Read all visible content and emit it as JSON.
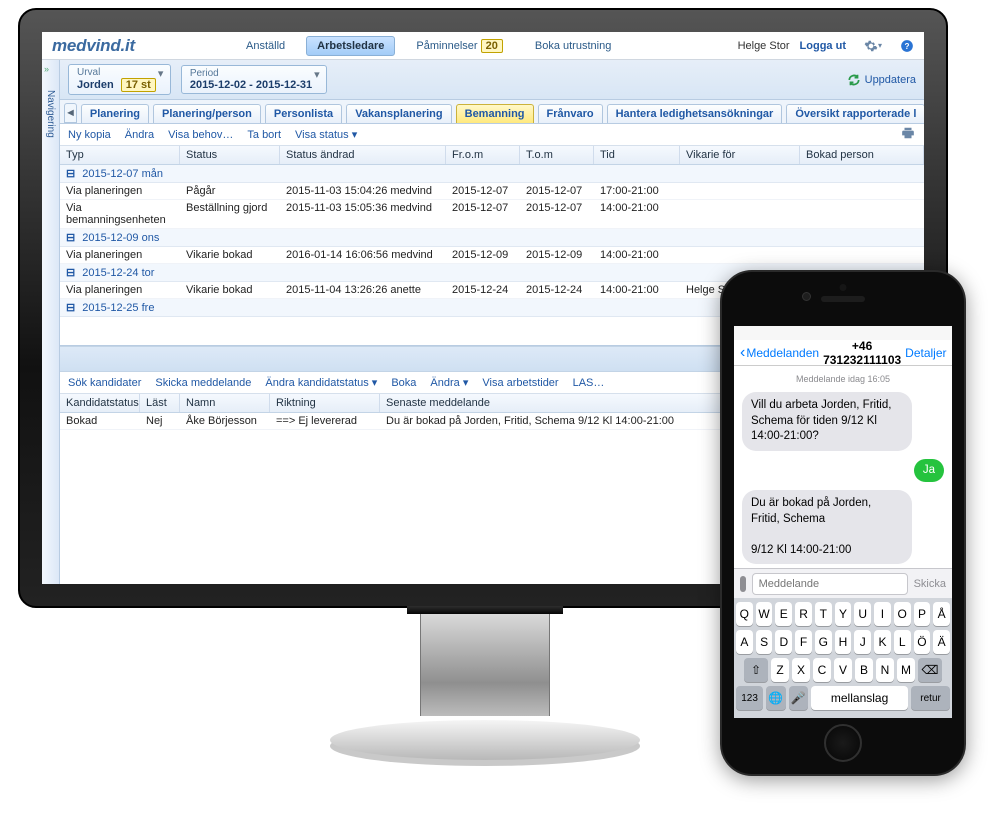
{
  "app": {
    "logo": "medvind.it"
  },
  "topnav": {
    "items": [
      "Anställd",
      "Arbetsledare",
      "Påminnelser",
      "Boka utrustning"
    ],
    "active": 1,
    "reminder_count": "20",
    "user": "Helge Stor",
    "logout": "Logga ut"
  },
  "sidenav": {
    "label": "Navigering"
  },
  "selection": {
    "urval_label": "Urval",
    "urval_value": "Jorden",
    "urval_count": "17 st",
    "period_label": "Period",
    "period_value": "2015-12-02 - 2015-12-31",
    "update": "Uppdatera"
  },
  "tabs": {
    "items": [
      "Planering",
      "Planering/person",
      "Personlista",
      "Vakansplanering",
      "Bemanning",
      "Frånvaro",
      "Hantera ledighetsansökningar",
      "Översikt rapporterade l"
    ],
    "active": 4
  },
  "toolbar": [
    "Ny kopia",
    "Ändra",
    "Visa behov…",
    "Ta bort",
    "Visa status ▾"
  ],
  "grid_headers": [
    "Typ",
    "Status",
    "Status ändrad",
    "Fr.o.m",
    "T.o.m",
    "Tid",
    "Vikarie för",
    "Bokad person"
  ],
  "groups": [
    {
      "label": "2015-12-07 mån",
      "rows": [
        {
          "typ": "Via planeringen",
          "status": "Pågår",
          "andrad": "2015-11-03 15:04:26 medvind",
          "from": "2015-12-07",
          "tom": "2015-12-07",
          "tid": "17:00-21:00",
          "vik": "",
          "bok": ""
        },
        {
          "typ": "Via bemanningsenheten",
          "status": "Beställning gjord",
          "andrad": "2015-11-03 15:05:36 medvind",
          "from": "2015-12-07",
          "tom": "2015-12-07",
          "tid": "14:00-21:00",
          "vik": "",
          "bok": ""
        }
      ]
    },
    {
      "label": "2015-12-09 ons",
      "rows": [
        {
          "typ": "Via planeringen",
          "status": "Vikarie bokad",
          "andrad": "2016-01-14 16:06:56 medvind",
          "from": "2015-12-09",
          "tom": "2015-12-09",
          "tid": "14:00-21:00",
          "vik": "",
          "bok": ""
        }
      ]
    },
    {
      "label": "2015-12-24 tor",
      "current": true,
      "rows": [
        {
          "typ": "Via planeringen",
          "status": "Vikarie bokad",
          "andrad": "2015-11-04 13:26:26 anette",
          "from": "2015-12-24",
          "tom": "2015-12-24",
          "tid": "14:00-21:00",
          "vik": "Helge S",
          "bok": ""
        }
      ]
    },
    {
      "label": "2015-12-25 fre",
      "rows": []
    }
  ],
  "lower_toolbar": [
    "Sök kandidater",
    "Skicka meddelande",
    "Ändra kandidatstatus ▾",
    "Boka",
    "Ändra ▾",
    "Visa arbetstider",
    "LAS…"
  ],
  "lower_headers": [
    "Kandidatstatus",
    "Läst",
    "Namn",
    "Riktning",
    "Senaste meddelande"
  ],
  "lower_rows": [
    {
      "kstat": "Bokad",
      "last": "Nej",
      "namn": "Åke Börjesson",
      "rikt": "==> Ej levererad",
      "sen": "Du är bokad på Jorden, Fritid, Schema 9/12 Kl 14:00-21:00"
    }
  ],
  "phone": {
    "back": "Meddelanden",
    "title": "+46 731232111103",
    "details": "Detaljer",
    "timestamp": "Meddelande idag 16:05",
    "msg1": "Vill du arbeta Jorden, Fritid, Schema för tiden 9/12 Kl 14:00-21:00?",
    "reply": "Ja",
    "msg2a": "Du är bokad på Jorden, Fritid, Schema",
    "msg2b": "9/12 Kl 14:00-21:00",
    "placeholder": "Meddelande",
    "send": "Skicka",
    "keys_r1": [
      "Q",
      "W",
      "E",
      "R",
      "T",
      "Y",
      "U",
      "I",
      "O",
      "P",
      "Å"
    ],
    "keys_r2": [
      "A",
      "S",
      "D",
      "F",
      "G",
      "H",
      "J",
      "K",
      "L",
      "Ö",
      "Ä"
    ],
    "keys_r3": [
      "Z",
      "X",
      "C",
      "V",
      "B",
      "N",
      "M"
    ],
    "key_123": "123",
    "key_space": "mellanslag",
    "key_return": "retur"
  }
}
